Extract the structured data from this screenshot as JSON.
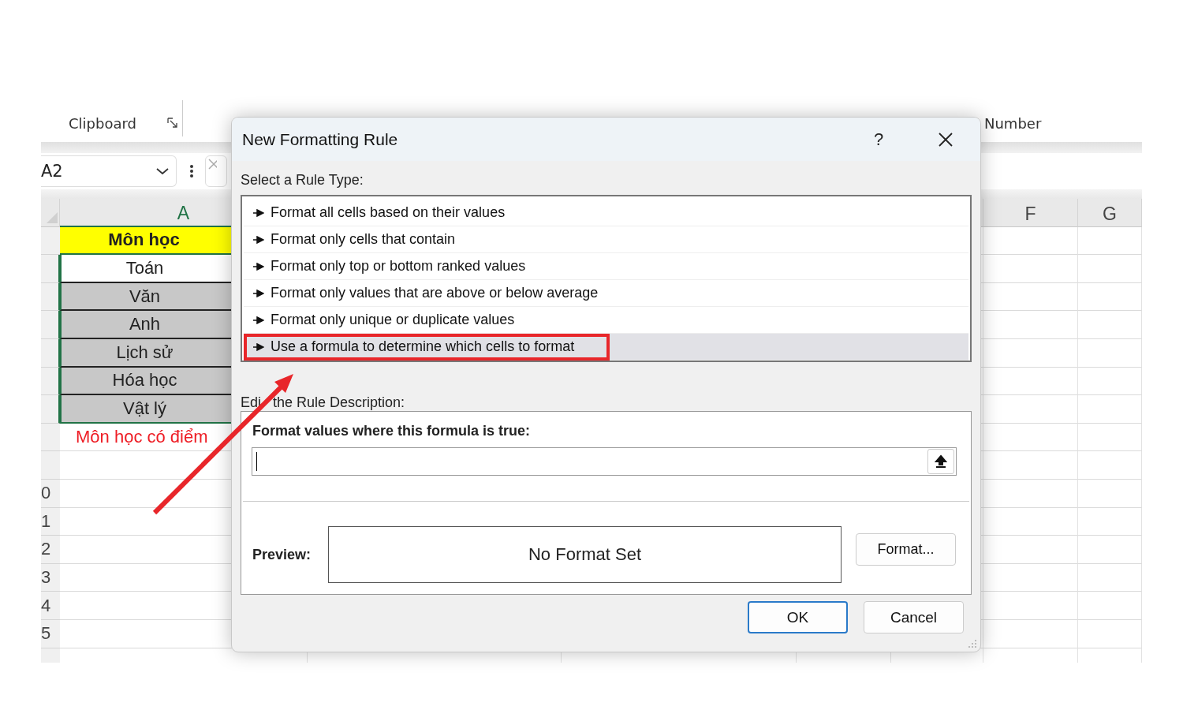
{
  "ribbon": {
    "groups": [
      {
        "label": "Clipboard",
        "launcher": true
      },
      {
        "label": "Number",
        "launcher": false
      }
    ]
  },
  "formula_bar": {
    "name_box": "A2"
  },
  "sheet": {
    "columns": [
      {
        "label": "A",
        "selected": true
      },
      {
        "label": "F",
        "selected": false
      },
      {
        "label": "G",
        "selected": false
      }
    ],
    "rows": [
      {
        "cell_a": "Môn học",
        "kind": "header",
        "selected": false
      },
      {
        "cell_a": "Toán",
        "kind": "plain",
        "selected": true
      },
      {
        "cell_a": "Văn",
        "kind": "shaded",
        "selected": true
      },
      {
        "cell_a": "Anh",
        "kind": "shaded",
        "selected": true
      },
      {
        "cell_a": "Lịch sử",
        "kind": "shaded",
        "selected": true
      },
      {
        "cell_a": "Hóa học",
        "kind": "shaded",
        "selected": true
      },
      {
        "cell_a": "Vật lý",
        "kind": "shaded",
        "selected": true
      },
      {
        "cell_a": "Môn học có điểm",
        "kind": "note",
        "selected": false
      },
      {
        "kind": "empty",
        "selected": false
      },
      {
        "row_number": "0",
        "kind": "empty",
        "selected": false
      },
      {
        "row_number": "1",
        "kind": "empty",
        "selected": false
      },
      {
        "row_number": "2",
        "kind": "empty",
        "selected": false
      },
      {
        "row_number": "3",
        "kind": "empty",
        "selected": false
      },
      {
        "row_number": "4",
        "kind": "empty",
        "selected": false
      },
      {
        "row_number": "5",
        "kind": "empty",
        "selected": false
      },
      {
        "kind": "empty",
        "selected": false
      }
    ]
  },
  "dialog": {
    "title": "New Formatting Rule",
    "help": "?",
    "rule_type_label": "Select a Rule Type:",
    "rule_types": [
      {
        "label": "Format all cells based on their values",
        "selected": false
      },
      {
        "label": "Format only cells that contain",
        "selected": false
      },
      {
        "label": "Format only top or bottom ranked values",
        "selected": false
      },
      {
        "label": "Format only values that are above or below average",
        "selected": false
      },
      {
        "label": "Format only unique or duplicate values",
        "selected": false
      },
      {
        "label": "Use a formula to determine which cells to format",
        "selected": true
      }
    ],
    "description_label_start": "Edi",
    "description_label_end": "the Rule Description:",
    "formula_label": "Format values where this formula is true:",
    "preview_label": "Preview:",
    "preview_text": "No Format Set",
    "format_button": "Format...",
    "buttons": [
      {
        "label": "OK",
        "default": true
      },
      {
        "label": "Cancel",
        "default": false
      }
    ]
  }
}
